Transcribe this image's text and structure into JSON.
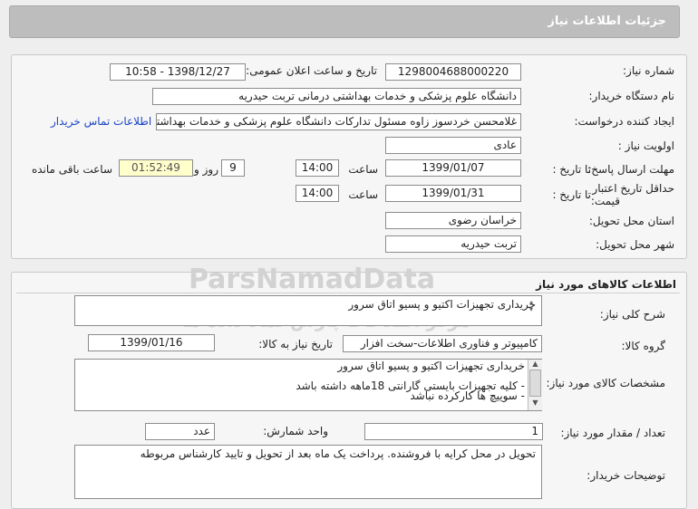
{
  "header": {
    "title": "جزئیات اطلاعات نیاز"
  },
  "info": {
    "need_number_label": "شماره نیاز:",
    "need_number": "1298004688000220",
    "announce_label": "تاریخ و ساعت اعلان عمومی:",
    "announce_value": "1398/12/27 - 10:58",
    "buyer_org_label": "نام دستگاه خریدار:",
    "buyer_org": "دانشگاه علوم پزشکی و خدمات بهداشتی درمانی تربت حیدریه",
    "creator_label": "ایجاد کننده درخواست:",
    "creator": "غلامحسن خردسوز زاوه مسئول تدارکات دانشگاه علوم پزشکی و خدمات بهداشتی",
    "contact_link": "اطلاعات تماس خریدار",
    "priority_label": "اولویت نیاز :",
    "priority": "عادی",
    "reply_deadline_label": "مهلت ارسال پاسخ:",
    "to_date_label": "تا تاریخ :",
    "reply_date": "1399/01/07",
    "hour_label": "ساعت",
    "reply_time": "14:00",
    "days_value": "9",
    "day_and_label": "روز و",
    "remaining_time": "01:52:49",
    "remaining_label": "ساعت باقی مانده",
    "validity_label_1": "حداقل تاریخ اعتبار",
    "validity_label_2": "قیمت:",
    "validity_to_label": "تا تاریخ :",
    "validity_date": "1399/01/31",
    "validity_hour_label": "ساعت",
    "validity_time": "14:00",
    "province_label": "استان محل تحویل:",
    "province": "خراسان رضوی",
    "city_label": "شهر محل تحویل:",
    "city": "تربت حیدریه"
  },
  "goods": {
    "section_title": "اطلاعات کالاهای مورد نیاز",
    "desc_label": "شرح کلی نیاز:",
    "desc": "خریداری تجهیزات اکتیو و پسیو اتاق سرور",
    "group_label": "گروه کالا:",
    "group": "کامپیوتر و فناوری اطلاعات-سخت افزار",
    "need_date_label": "تاریخ نیاز به کالا:",
    "need_date": "1399/01/16",
    "spec_label": "مشخصات کالای مورد نیاز:",
    "spec_lines": [
      "خریداری تجهیزات اکتیو و پسیو اتاق سرور",
      "",
      "- کلیه تجهیزات بایستی گارانتی 18ماهه داشته باشد",
      "- سوییچ ها کارکرده نباشد"
    ],
    "qty_label": "تعداد / مقدار مورد نیاز:",
    "qty": "1",
    "unit_label": "واحد شمارش:",
    "unit": "عدد",
    "buyer_notes_label": "توضیحات خریدار:",
    "buyer_notes": "تحویل در محل  کرایه با فروشنده. پرداخت یک ماه بعد از تحویل و تایید کارشناس مربوطه"
  },
  "watermark": {
    "line1": "ParsNamadData",
    "line2": "مرکز اطلاعات پارس نماد داده ها",
    "line3": "۰۲۱-۸۸۳۴۹۶۷۰"
  }
}
